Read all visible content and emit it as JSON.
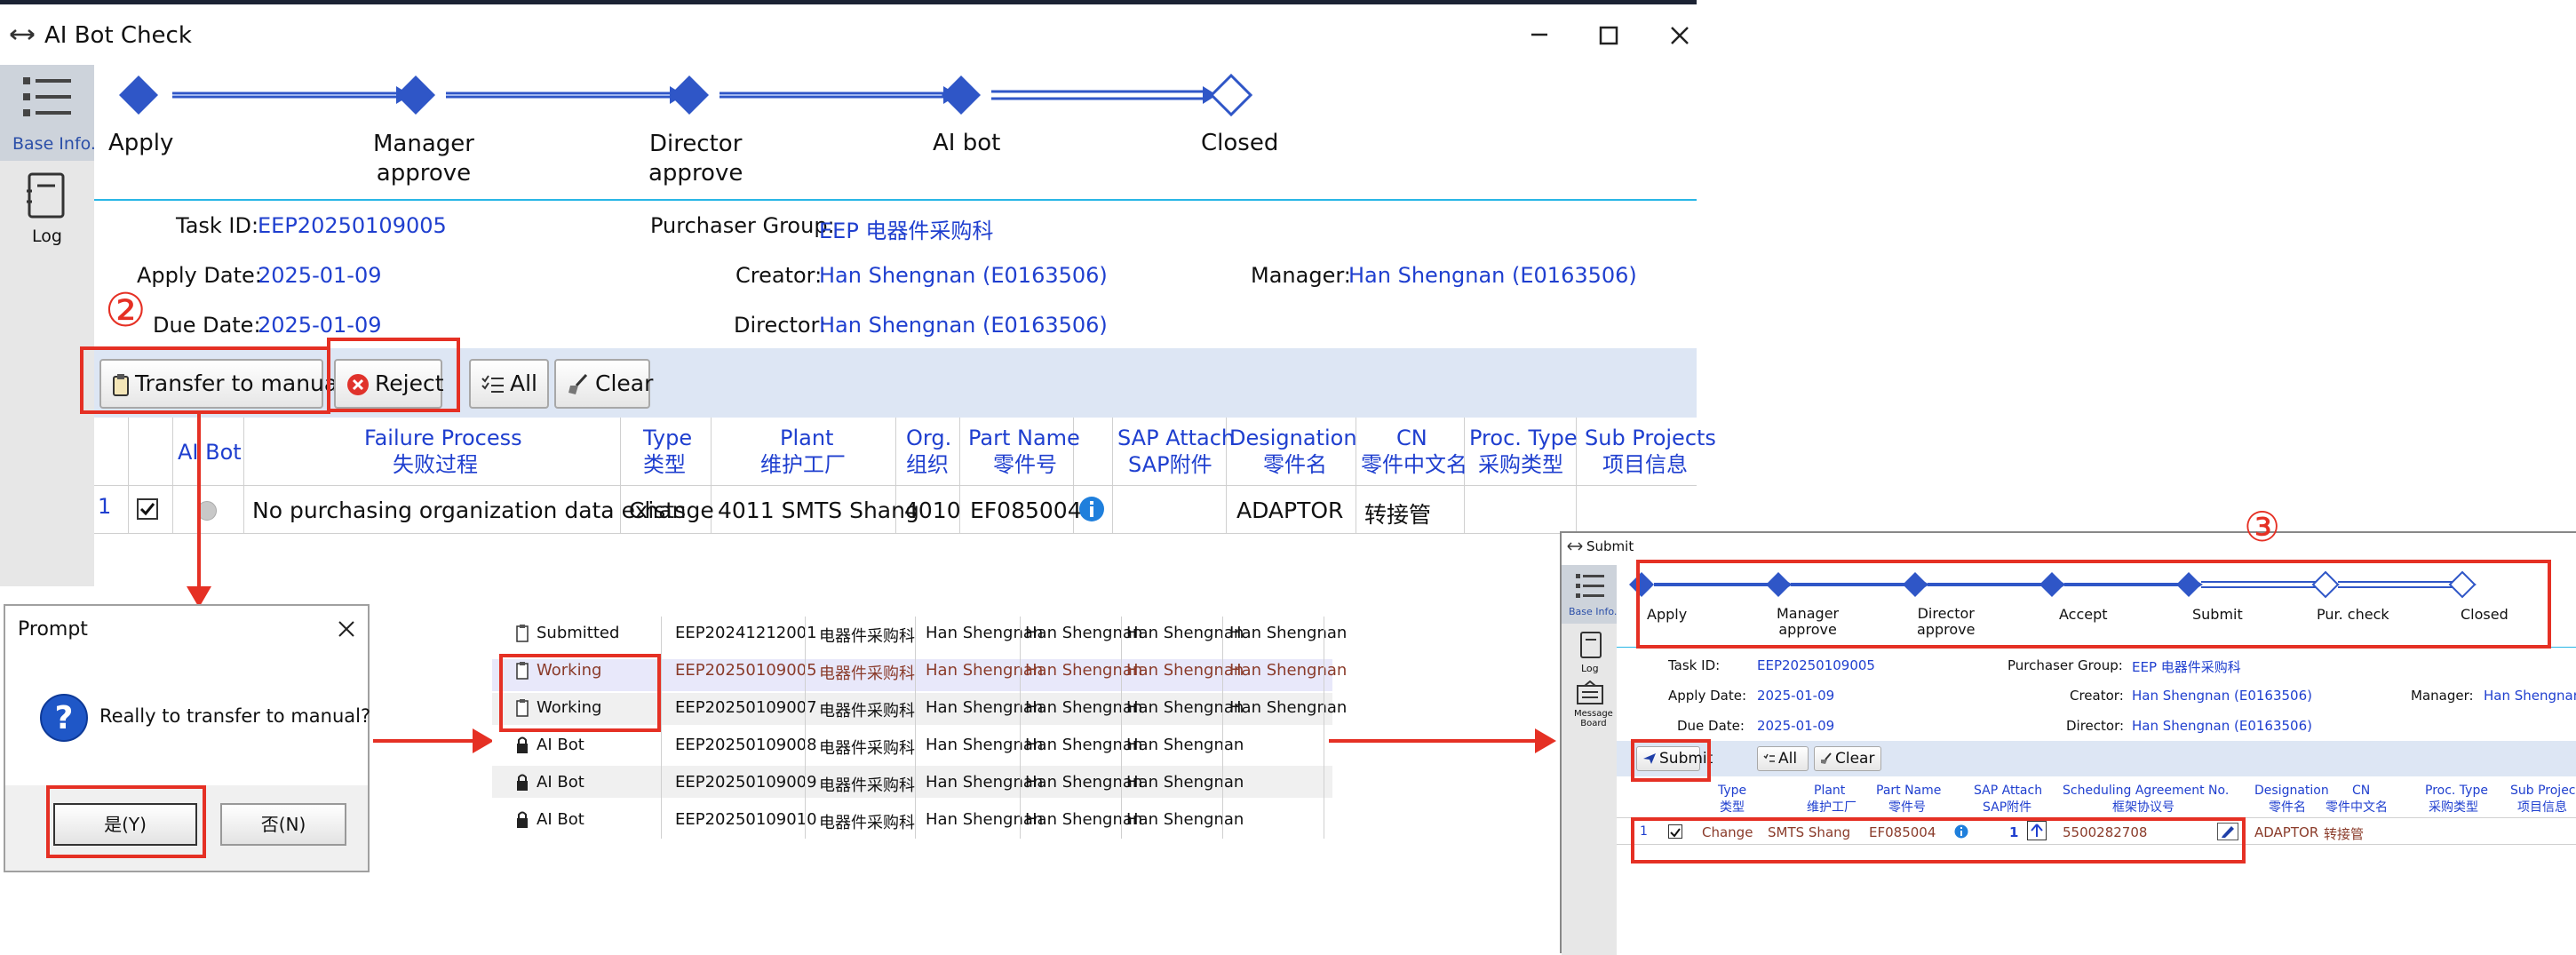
{
  "main": {
    "title": "AI Bot Check",
    "sidebar": [
      {
        "label": "Base Info.",
        "icon": "list-icon"
      },
      {
        "label": "Log",
        "icon": "notebook-icon"
      }
    ],
    "steps": [
      {
        "label": "Apply",
        "done": true
      },
      {
        "label": "Manager\napprove",
        "done": true
      },
      {
        "label": "Director\napprove",
        "done": true
      },
      {
        "label": "AI bot",
        "done": true
      },
      {
        "label": "Closed",
        "done": false
      }
    ],
    "info": {
      "task_id_label": "Task ID:",
      "task_id": "EEP20250109005",
      "purchaser_group_label": "Purchaser Group:",
      "purchaser_group": "EEP 电器件采购科",
      "apply_date_label": "Apply Date:",
      "apply_date": "2025-01-09",
      "creator_label": "Creator:",
      "creator": "Han Shengnan (E0163506)",
      "manager_label": "Manager:",
      "manager": "Han Shengnan (E0163506)",
      "due_date_label": "Due Date:",
      "due_date": "2025-01-09",
      "director_label": "Director:",
      "director": "Han Shengnan (E0163506)"
    },
    "toolbar": {
      "transfer": "Transfer to manual",
      "reject": "Reject",
      "all": "All",
      "clear": "Clear"
    },
    "columns": [
      {
        "en": "AI Bot",
        "cn": ""
      },
      {
        "en": "Failure Process",
        "cn": "失败过程"
      },
      {
        "en": "Type",
        "cn": "类型"
      },
      {
        "en": "Plant",
        "cn": "维护工厂"
      },
      {
        "en": "Org.",
        "cn": "组织"
      },
      {
        "en": "Part Name",
        "cn": "零件号"
      },
      {
        "en": "SAP Attach",
        "cn": "SAP附件"
      },
      {
        "en": "Designation",
        "cn": "零件名"
      },
      {
        "en": "CN",
        "cn": "零件中文名"
      },
      {
        "en": "Proc. Type",
        "cn": "采购类型"
      },
      {
        "en": "Sub Projects",
        "cn": "项目信息"
      }
    ],
    "row": {
      "num": "1",
      "failure": "No purchasing organization data exists",
      "type": "Change",
      "plant": "4011 SMTS Shang",
      "org": "4010",
      "part": "EF085004",
      "designation": "ADAPTOR",
      "cn": "转接管"
    }
  },
  "annotations": {
    "step2": "②",
    "step3": "③"
  },
  "prompt": {
    "title": "Prompt",
    "message": "Really to transfer to manual?",
    "yes": "是(Y)",
    "no": "否(N)"
  },
  "list": {
    "rows": [
      {
        "status": "Submitted",
        "id": "EEP20241212001",
        "group": "电器件采购科",
        "n1": "Han Shengnan",
        "n2": "Han Shengnan",
        "n3": "Han Shengnan",
        "n4": "Han Shengnan"
      },
      {
        "status": "Working",
        "id": "EEP20250109005",
        "group": "电器件采购科",
        "n1": "Han Shengnan",
        "n2": "Han Shengnan",
        "n3": "Han Shengnan",
        "n4": "Han Shengnan"
      },
      {
        "status": "Working",
        "id": "EEP20250109007",
        "group": "电器件采购科",
        "n1": "Han Shengnan",
        "n2": "Han Shengnan",
        "n3": "Han Shengnan",
        "n4": "Han Shengnan"
      },
      {
        "status": "AI Bot",
        "id": "EEP20250109008",
        "group": "电器件采购科",
        "n1": "Han Shengnan",
        "n2": "Han Shengnan",
        "n3": "Han Shengnan",
        "n4": ""
      },
      {
        "status": "AI Bot",
        "id": "EEP20250109009",
        "group": "电器件采购科",
        "n1": "Han Shengnan",
        "n2": "Han Shengnan",
        "n3": "Han Shengnan",
        "n4": ""
      },
      {
        "status": "AI Bot",
        "id": "EEP20250109010",
        "group": "电器件采购科",
        "n1": "Han Shengnan",
        "n2": "Han Shengnan",
        "n3": "Han Shengnan",
        "n4": ""
      }
    ]
  },
  "submit": {
    "title": "Submit",
    "sidebar": [
      {
        "label": "Base Info.",
        "icon": "list-icon"
      },
      {
        "label": "Log",
        "icon": "notebook-icon"
      },
      {
        "label": "Message\nBoard",
        "icon": "message-board-icon"
      }
    ],
    "steps": [
      {
        "label": "Apply",
        "done": true
      },
      {
        "label": "Manager\napprove",
        "done": true
      },
      {
        "label": "Director\napprove",
        "done": true
      },
      {
        "label": "Accept",
        "done": true
      },
      {
        "label": "Submit",
        "done": true
      },
      {
        "label": "Pur. check",
        "done": false
      },
      {
        "label": "Closed",
        "done": false
      }
    ],
    "info": {
      "task_id_label": "Task ID:",
      "task_id": "EEP20250109005",
      "purchaser_group_label": "Purchaser Group:",
      "purchaser_group": "EEP 电器件采购科",
      "apply_date_label": "Apply Date:",
      "apply_date": "2025-01-09",
      "creator_label": "Creator:",
      "creator": "Han Shengnan (E0163506)",
      "manager_label": "Manager:",
      "manager": "Han Shengnan",
      "due_date_label": "Due Date:",
      "due_date": "2025-01-09",
      "director_label": "Director:",
      "director": "Han Shengnan (E0163506)"
    },
    "toolbar": {
      "submit": "Submit",
      "all": "All",
      "clear": "Clear"
    },
    "columns": [
      {
        "en": "Type",
        "cn": "类型"
      },
      {
        "en": "Plant",
        "cn": "维护工厂"
      },
      {
        "en": "Part Name",
        "cn": "零件号"
      },
      {
        "en": "SAP Attach",
        "cn": "SAP附件"
      },
      {
        "en": "Scheduling Agreement No.",
        "cn": "框架协议号"
      },
      {
        "en": "Designation",
        "cn": "零件名"
      },
      {
        "en": "CN",
        "cn": "零件中文名"
      },
      {
        "en": "Proc. Type",
        "cn": "采购类型"
      },
      {
        "en": "Sub Projec",
        "cn": "项目信息"
      }
    ],
    "row": {
      "num": "1",
      "type": "Change",
      "plant": "SMTS Shang",
      "part": "EF085004",
      "attach_count": "1",
      "agreement": "5500282708",
      "designation": "ADAPTOR",
      "cn": "转接管"
    }
  },
  "colors": {
    "accent": "#1f3fcf",
    "annotation": "#e53024",
    "step": "#2f56c7",
    "side": "#e7e7e7"
  }
}
